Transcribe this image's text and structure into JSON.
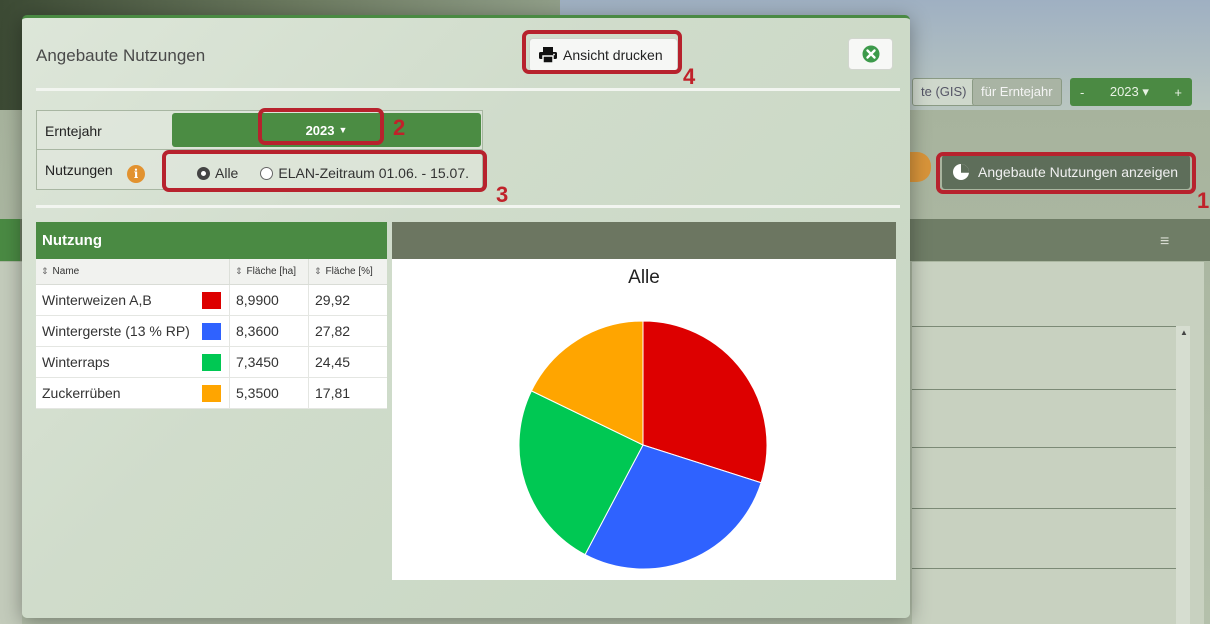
{
  "background": {
    "gis_button": "te (GIS)",
    "year_label": "für Erntejahr",
    "year_value": "2023",
    "year_minus": "-",
    "year_plus": "+",
    "show_button": "Angebaute Nutzungen anzeigen",
    "hamburger": "≡"
  },
  "modal": {
    "title": "Angebaute Nutzungen",
    "print_label": "Ansicht drucken",
    "form": {
      "year_label": "Erntejahr",
      "year_value": "2023",
      "usage_label": "Nutzungen",
      "radio_all": "Alle",
      "radio_elan": "ELAN-Zeitraum 01.06. - 15.07.",
      "selected": "Alle"
    },
    "table": {
      "title": "Nutzung",
      "columns": [
        "Name",
        "Fläche [ha]",
        "Fläche [%]"
      ],
      "rows": [
        {
          "name": "Winterweizen A,B",
          "color": "#dd0000",
          "ha": "8,9900",
          "pct": "29,92"
        },
        {
          "name": "Wintergerste (13 % RP)",
          "color": "#2f62ff",
          "ha": "8,3600",
          "pct": "27,82"
        },
        {
          "name": "Winterraps",
          "color": "#00c853",
          "ha": "7,3450",
          "pct": "24,45"
        },
        {
          "name": "Zuckerrüben",
          "color": "#ffa500",
          "ha": "5,3500",
          "pct": "17,81"
        }
      ]
    }
  },
  "annotations": [
    "1",
    "2",
    "3",
    "4"
  ],
  "chart_data": {
    "type": "pie",
    "title": "Alle",
    "categories": [
      "Winterweizen A,B",
      "Wintergerste (13 % RP)",
      "Winterraps",
      "Zuckerrüben"
    ],
    "values": [
      29.92,
      27.82,
      24.45,
      17.81
    ],
    "colors": [
      "#dd0000",
      "#2f62ff",
      "#00c853",
      "#ffa500"
    ]
  }
}
